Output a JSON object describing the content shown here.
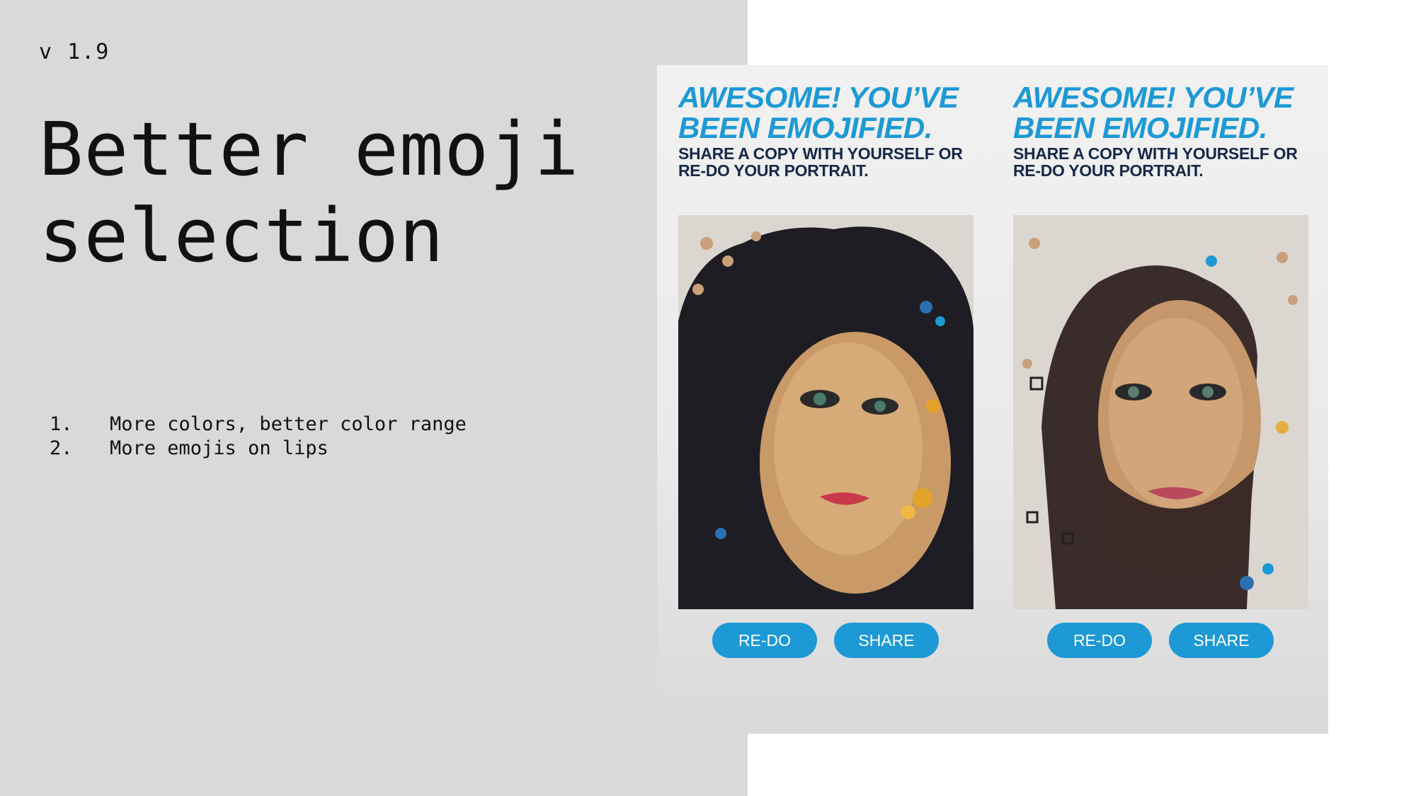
{
  "slide": {
    "version": "v 1.9",
    "title_line1": "Better emoji",
    "title_line2": "selection",
    "points": [
      {
        "num": "1.",
        "text": "More colors, better color range"
      },
      {
        "num": "2.",
        "text": "More emojis on lips"
      }
    ]
  },
  "screens": [
    {
      "headline_line1": "AWESOME! YOU’VE",
      "headline_line2": "BEEN EMOJIFIED.",
      "sub_line1": "SHARE A COPY WITH YOURSELF OR",
      "sub_line2": "RE-DO YOUR PORTRAIT.",
      "redo_label": "RE-DO",
      "share_label": "SHARE"
    },
    {
      "headline_line1": "AWESOME! YOU’VE",
      "headline_line2": "BEEN EMOJIFIED.",
      "sub_line1": "SHARE A COPY WITH YOURSELF OR",
      "sub_line2": "RE-DO YOUR PORTRAIT.",
      "redo_label": "RE-DO",
      "share_label": "SHARE"
    }
  ],
  "colors": {
    "accent_blue": "#1d9ad6",
    "navy": "#16284a",
    "panel_gray": "#d9d9d9"
  }
}
